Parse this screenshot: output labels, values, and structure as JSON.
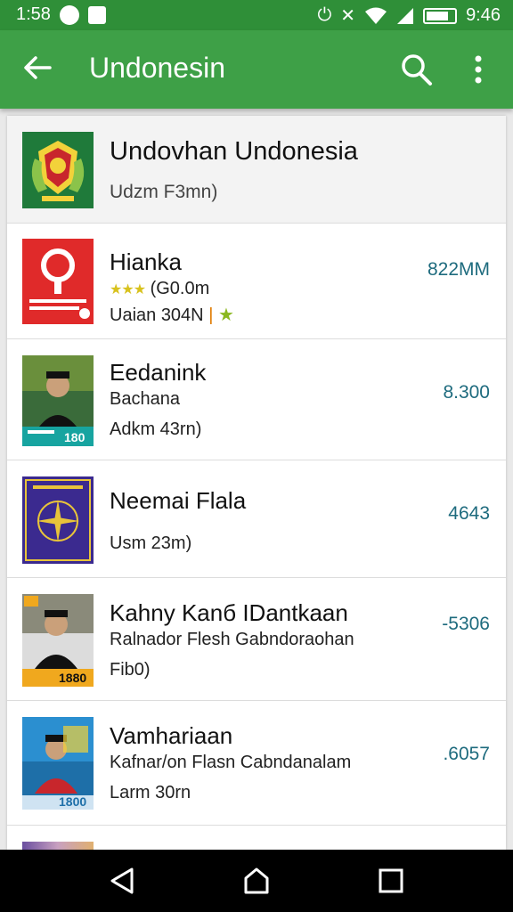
{
  "status_bar": {
    "time_left": "1:58",
    "time_right": "9:46"
  },
  "appbar": {
    "title": "Undonesin"
  },
  "header": {
    "title": "Undovhan Undonesia",
    "subtitle": "Udzm F3mn)"
  },
  "items": [
    {
      "title": "Hianka",
      "line2": "(G0.0m",
      "line3": "Uaian 304N",
      "value": "822MM",
      "has_stars": true
    },
    {
      "title": "Eedanink",
      "line2": "Bachana",
      "line3": "Adkm 43rn)",
      "value": "8.300",
      "thumb_badge": "180"
    },
    {
      "title": "Neemai Flala",
      "line2": "",
      "line3": "Usm 23m)",
      "value": "4643"
    },
    {
      "title": "Kahny Kanб IDantkaan",
      "line2": "Ralnador Flesh Gabndoraohan",
      "line3": "Fib0)",
      "value": "-5306",
      "thumb_badge": "1880"
    },
    {
      "title": "Vamhariaan",
      "line2": "Kafnar/on Flasn Cabndanalam",
      "line3": "Larm 30rn",
      "value": ".6057",
      "thumb_badge": "1800"
    }
  ],
  "colors": {
    "status_bar": "#2f8f38",
    "app_bar": "#3ea047",
    "value_text": "#1e6b7e"
  },
  "icons": [
    "back-arrow-icon",
    "search-icon",
    "more-vert-icon",
    "nav-back-icon",
    "nav-home-icon",
    "nav-recents-icon"
  ]
}
